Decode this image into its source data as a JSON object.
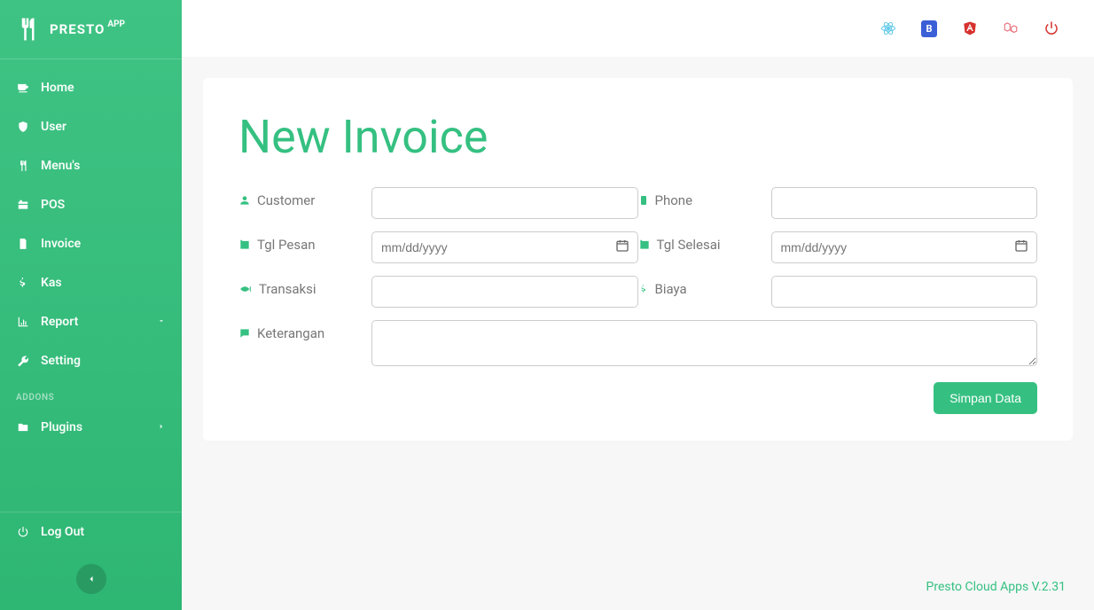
{
  "brand": {
    "name": "PRESTO",
    "sup": "APP"
  },
  "sidebar": {
    "items": [
      {
        "label": "Home"
      },
      {
        "label": "User"
      },
      {
        "label": "Menu's"
      },
      {
        "label": "POS"
      },
      {
        "label": "Invoice"
      },
      {
        "label": "Kas"
      },
      {
        "label": "Report"
      },
      {
        "label": "Setting"
      }
    ],
    "addons_label": "ADDONS",
    "addons": [
      {
        "label": "Plugins"
      }
    ],
    "logout": "Log Out"
  },
  "topbar": {
    "bootstrap_badge": "B"
  },
  "page": {
    "title": "New Invoice",
    "labels": {
      "customer": "Customer",
      "phone": "Phone",
      "tgl_pesan": "Tgl Pesan",
      "tgl_selesai": "Tgl Selesai",
      "transaksi": "Transaksi",
      "biaya": "Biaya",
      "keterangan": "Keterangan"
    },
    "placeholders": {
      "date": "mm/dd/yyyy"
    },
    "values": {
      "customer": "",
      "phone": "",
      "tgl_pesan": "",
      "tgl_selesai": "",
      "transaksi": "",
      "biaya": "",
      "keterangan": ""
    },
    "submit": "Simpan Data"
  },
  "footer": {
    "text": "Presto Cloud Apps V.2.31"
  }
}
